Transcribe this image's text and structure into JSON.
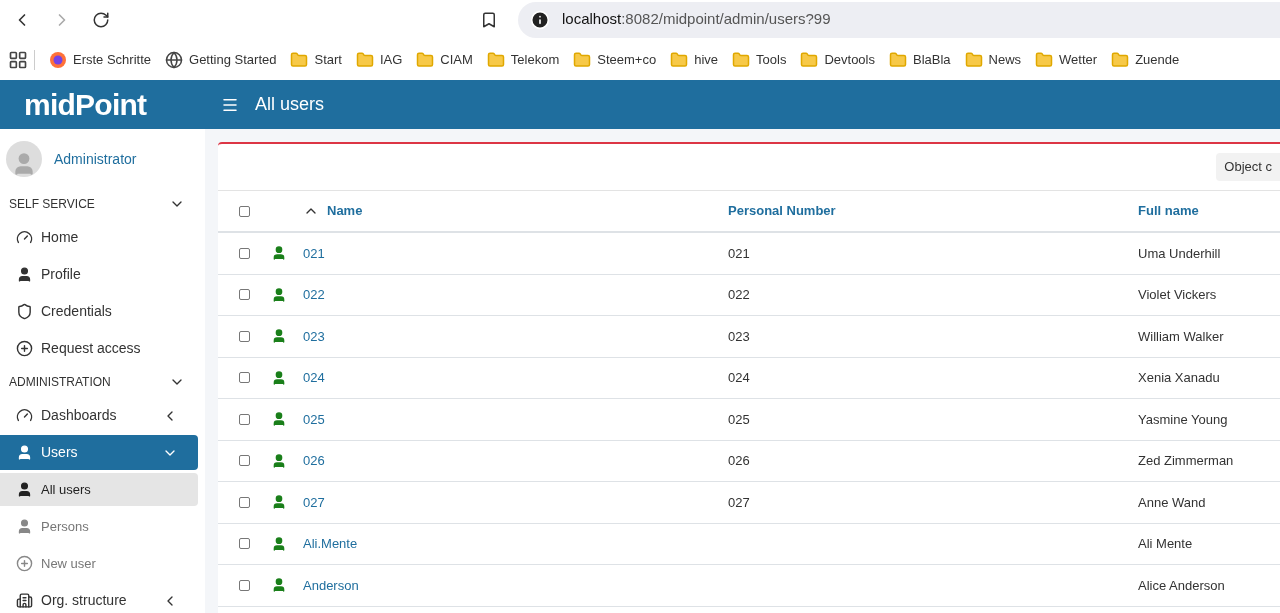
{
  "browser": {
    "url_host": "localhost",
    "url_rest": ":8082/midpoint/admin/users?99"
  },
  "bookmarks": [
    {
      "label": "Erste Schritte",
      "kind": "firefox"
    },
    {
      "label": "Getting Started",
      "kind": "globe"
    },
    {
      "label": "Start",
      "kind": "folder"
    },
    {
      "label": "IAG",
      "kind": "folder"
    },
    {
      "label": "CIAM",
      "kind": "folder"
    },
    {
      "label": "Telekom",
      "kind": "folder"
    },
    {
      "label": "Steem+co",
      "kind": "folder"
    },
    {
      "label": "hive",
      "kind": "folder"
    },
    {
      "label": "Tools",
      "kind": "folder"
    },
    {
      "label": "Devtools",
      "kind": "folder"
    },
    {
      "label": "BlaBla",
      "kind": "folder"
    },
    {
      "label": "News",
      "kind": "folder"
    },
    {
      "label": "Wetter",
      "kind": "folder"
    },
    {
      "label": "Zuende",
      "kind": "folder"
    }
  ],
  "header": {
    "logo": "midPoint",
    "title": "All users"
  },
  "sidebar": {
    "user": "Administrator",
    "sections": [
      {
        "title": "SELF SERVICE",
        "expanded": true,
        "items": [
          {
            "label": "Home",
            "kind": "gauge",
            "selected": false
          },
          {
            "label": "Profile",
            "kind": "user",
            "selected": false
          },
          {
            "label": "Credentials",
            "kind": "shield",
            "selected": false
          },
          {
            "label": "Request access",
            "kind": "plus",
            "selected": false
          }
        ]
      },
      {
        "title": "ADMINISTRATION",
        "expanded": true,
        "items": [
          {
            "label": "Dashboards",
            "kind": "gauge",
            "expanded": false,
            "selected": false
          },
          {
            "label": "Users",
            "kind": "user",
            "expanded": true,
            "selected": true,
            "children": [
              {
                "label": "All users",
                "kind": "user",
                "selected": true
              },
              {
                "label": "Persons",
                "kind": "user",
                "selected": false
              },
              {
                "label": "New user",
                "kind": "plus",
                "selected": false
              }
            ]
          },
          {
            "label": "Org. structure",
            "kind": "building",
            "expanded": false,
            "selected": false
          }
        ]
      }
    ]
  },
  "table": {
    "toolbar_button": "Object c",
    "columns": [
      "Name",
      "Personal Number",
      "Full name"
    ],
    "sorted_ascending": true,
    "all_checked": false,
    "rows": [
      {
        "name": "021",
        "number": "021",
        "full_name": "Uma Underhill",
        "checked": false
      },
      {
        "name": "022",
        "number": "022",
        "full_name": "Violet Vickers",
        "checked": false
      },
      {
        "name": "023",
        "number": "023",
        "full_name": "William Walker",
        "checked": false
      },
      {
        "name": "024",
        "number": "024",
        "full_name": "Xenia Xanadu",
        "checked": false
      },
      {
        "name": "025",
        "number": "025",
        "full_name": "Yasmine Young",
        "checked": false
      },
      {
        "name": "026",
        "number": "026",
        "full_name": "Zed Zimmerman",
        "checked": false
      },
      {
        "name": "027",
        "number": "027",
        "full_name": "Anne Wand",
        "checked": false
      },
      {
        "name": "Ali.Mente",
        "number": "",
        "full_name": "Ali Mente",
        "checked": false
      },
      {
        "name": "Anderson",
        "number": "",
        "full_name": "Alice Anderson",
        "checked": false
      }
    ]
  }
}
